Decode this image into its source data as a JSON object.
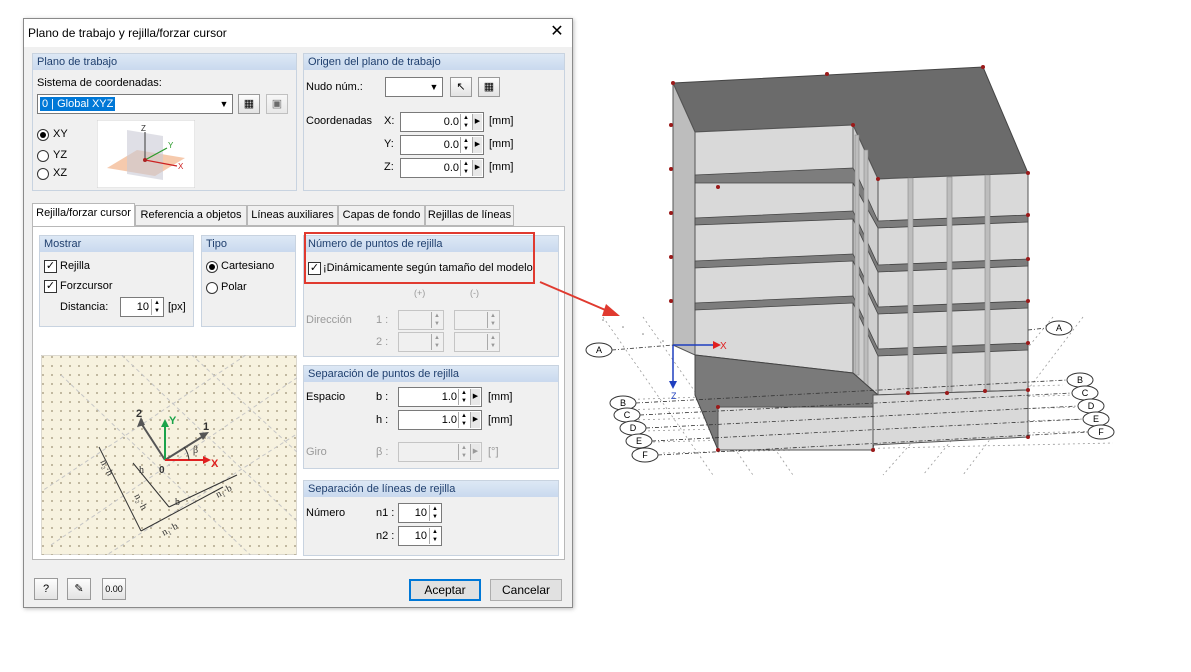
{
  "dialog": {
    "title": "Plano de trabajo y rejilla/forzar cursor",
    "close_symbol": "✕"
  },
  "work_plane": {
    "heading": "Plano de trabajo",
    "coord_system_label": "Sistema de coordenadas:",
    "coord_system_value": "0 | Global XYZ",
    "options": [
      "XY",
      "YZ",
      "XZ"
    ],
    "selected": "XY",
    "preview_axes": {
      "z": "Z",
      "y": "Y",
      "x": "X"
    }
  },
  "origin": {
    "heading": "Origen del plano de trabajo",
    "node_label": "Nudo núm.:",
    "node_value": "",
    "coords_label": "Coordenadas",
    "fields": [
      {
        "axis": "X:",
        "value": "0.0",
        "unit": "[mm]"
      },
      {
        "axis": "Y:",
        "value": "0.0",
        "unit": "[mm]"
      },
      {
        "axis": "Z:",
        "value": "0.0",
        "unit": "[mm]"
      }
    ]
  },
  "tabs": [
    "Rejilla/forzar cursor",
    "Referencia a objetos",
    "Líneas auxiliares",
    "Capas de fondo",
    "Rejillas de líneas"
  ],
  "active_tab": "Rejilla/forzar cursor",
  "show": {
    "heading": "Mostrar",
    "grid_label": "Rejilla",
    "grid_checked": true,
    "snap_label": "Forzcursor",
    "snap_checked": true,
    "distance_label": "Distancia:",
    "distance_value": "10",
    "distance_unit": "[px]"
  },
  "type": {
    "heading": "Tipo",
    "options": [
      "Cartesiano",
      "Polar"
    ],
    "selected": "Cartesiano"
  },
  "grid_points": {
    "heading": "Número de puntos de rejilla",
    "dynamic_label": "¡Dinámicamente según tamaño del modelo!",
    "dynamic_checked": true,
    "col_plus": "(+)",
    "col_minus": "(-)",
    "direction_label": "Dirección",
    "row1": "1 :",
    "row2": "2 :"
  },
  "spacing": {
    "heading": "Separación de puntos de rejilla",
    "space_label": "Espacio",
    "b_label": "b :",
    "b_value": "1.0",
    "h_label": "h :",
    "h_value": "1.0",
    "unit": "[mm]",
    "rotation_label": "Giro",
    "beta_label": "β :",
    "beta_unit": "[°]"
  },
  "grid_lines": {
    "heading": "Separación de líneas de rejilla",
    "number_label": "Número",
    "n1_label": "n1 :",
    "n1_value": "10",
    "n2_label": "n2 :",
    "n2_value": "10"
  },
  "diagram_labels": {
    "axis2": "2",
    "axis1": "1",
    "y": "Y",
    "x": "X",
    "zero": "0",
    "beta": "β",
    "n2h": "n₂·h",
    "n2h_b": "n₂·h",
    "n1b": "n₁·b",
    "n1b_b": "n₁·b",
    "h": "h",
    "b": "b"
  },
  "footer": {
    "help_icon": "?",
    "edit_icon": "✎",
    "units_icon": "0.00",
    "ok": "Aceptar",
    "cancel": "Cancelar"
  },
  "model": {
    "axis_x": "X",
    "axis_z": "Z",
    "grid_labels_left": [
      "A",
      "B",
      "C",
      "D",
      "E",
      "F"
    ],
    "grid_labels_right": [
      "A",
      "B",
      "C",
      "D",
      "E",
      "F"
    ]
  },
  "colors": {
    "highlight_red": "#e03a2f",
    "header_blue": "#1f3f6e",
    "roof_gray": "#6b6b6b",
    "wall_light": "#d9d9d9"
  }
}
